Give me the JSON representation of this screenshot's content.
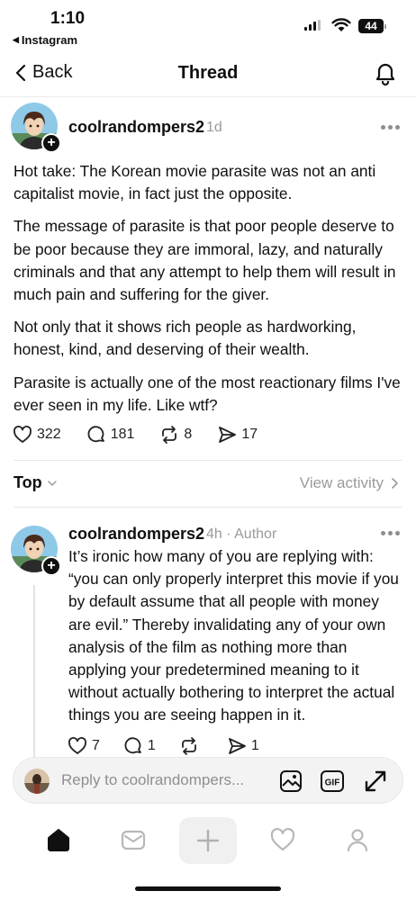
{
  "status_bar": {
    "time": "1:10",
    "back_app": "Instagram",
    "battery": "44"
  },
  "nav": {
    "back_label": "Back",
    "title": "Thread"
  },
  "post": {
    "username": "coolrandompers2",
    "age": "1d",
    "paragraphs": [
      "Hot take: The Korean movie parasite was not an anti capitalist movie, in fact just the opposite.",
      "The message of parasite is that poor people deserve to be poor because they are immoral, lazy, and naturally criminals and that any attempt to help them will result in much pain and suffering for the giver.",
      "Not only that it shows rich people as hardworking, honest, kind, and deserving of their wealth.",
      "Parasite is actually one of the most reactionary films I've ever seen in my life. Like wtf?"
    ],
    "likes": "322",
    "comments": "181",
    "reposts": "8",
    "shares": "17"
  },
  "sort": {
    "label": "Top",
    "view_activity": "View activity"
  },
  "reply": {
    "username": "coolrandompers2",
    "meta": "4h · Author",
    "text": "It’s ironic how many of you are replying with: “you can only properly interpret this movie if you by default assume that all people with money are evil.” Thereby invalidating any of your own analysis of the film as nothing more than applying your predetermined meaning to it without actually bothering to interpret the actual things you are seeing happen in it.",
    "likes": "7",
    "comments": "1",
    "reposts": "",
    "shares": "1"
  },
  "composer": {
    "placeholder": "Reply to coolrandompers..."
  },
  "colors": {
    "text": "#101010",
    "muted": "#9a9a9a",
    "divider": "#e6e6e6",
    "composer_bg": "#f3f3f3"
  },
  "icons": {
    "nav": [
      "chevron-left-icon",
      "bell-icon"
    ],
    "actions": [
      "heart-icon",
      "comment-icon",
      "repost-icon",
      "share-icon"
    ],
    "composer": [
      "image-icon",
      "gif-icon",
      "expand-icon"
    ],
    "tabs": [
      "home-icon",
      "inbox-icon",
      "plus-icon",
      "heart-icon",
      "profile-icon"
    ]
  }
}
